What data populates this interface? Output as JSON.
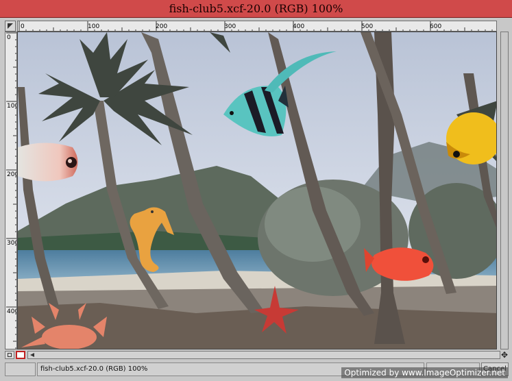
{
  "window": {
    "title": "fish-club5.xcf-20.0 (RGB) 100%"
  },
  "rulers": {
    "horizontal_labels": [
      "0",
      "100",
      "200",
      "300",
      "400",
      "500",
      "600"
    ],
    "vertical_labels": [
      "0",
      "100",
      "200",
      "300",
      "400"
    ]
  },
  "status": {
    "text": "fish-club5.xcf-20.0 (RGB) 100%",
    "cancel_label": "Cancel"
  },
  "watermark": {
    "text": "Optimized by www.ImageOptimizer.net"
  },
  "colors": {
    "title_bg": "#d04a4a",
    "chrome": "#c8c8c8",
    "ruler": "#e9e9e9"
  }
}
